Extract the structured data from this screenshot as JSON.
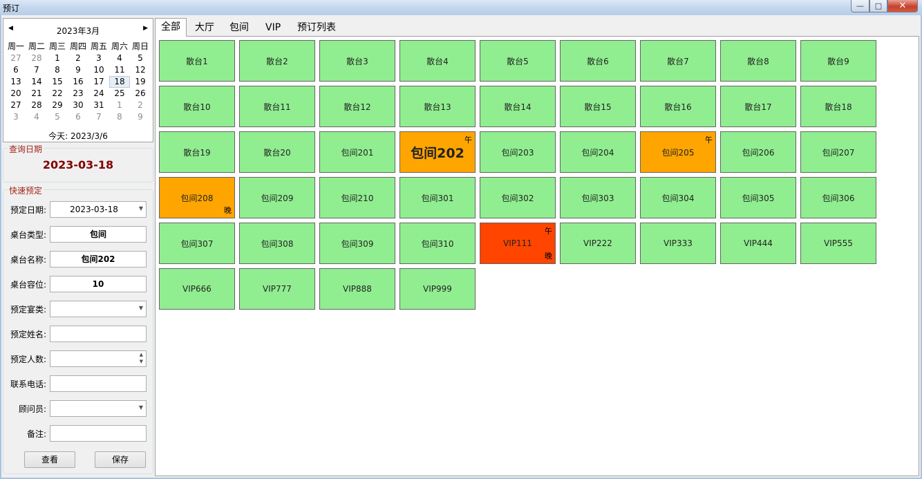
{
  "window": {
    "title": "预订",
    "buttons": {
      "minimize": "—",
      "maximize": "□",
      "close": "✕"
    }
  },
  "calendar": {
    "month_label": "2023年3月",
    "weekdays": [
      "周一",
      "周二",
      "周三",
      "周四",
      "周五",
      "周六",
      "周日"
    ],
    "weeks": [
      [
        "27",
        "28",
        "1",
        "2",
        "3",
        "4",
        "5"
      ],
      [
        "6",
        "7",
        "8",
        "9",
        "10",
        "11",
        "12"
      ],
      [
        "13",
        "14",
        "15",
        "16",
        "17",
        "18",
        "19"
      ],
      [
        "20",
        "21",
        "22",
        "23",
        "24",
        "25",
        "26"
      ],
      [
        "27",
        "28",
        "29",
        "30",
        "31",
        "1",
        "2"
      ],
      [
        "3",
        "4",
        "5",
        "6",
        "7",
        "8",
        "9"
      ]
    ],
    "selected_day": "18",
    "today_label": "今天: 2023/3/6"
  },
  "query": {
    "legend": "查询日期",
    "date": "2023-03-18"
  },
  "quick_booking": {
    "legend": "快速预定",
    "fields": [
      {
        "label": "预定日期:",
        "value": "2023-03-18",
        "kind": "combo"
      },
      {
        "label": "桌台类型:",
        "value": "包间",
        "kind": "text"
      },
      {
        "label": "桌台名称:",
        "value": "包间202",
        "kind": "text"
      },
      {
        "label": "桌台容位:",
        "value": "10",
        "kind": "text"
      },
      {
        "label": "预定宴类:",
        "value": "",
        "kind": "combo"
      },
      {
        "label": "预定姓名:",
        "value": "",
        "kind": "text"
      },
      {
        "label": "预定人数:",
        "value": "",
        "kind": "spin"
      },
      {
        "label": "联系电话:",
        "value": "",
        "kind": "text"
      },
      {
        "label": "顾问员:",
        "value": "",
        "kind": "combo"
      },
      {
        "label": "备注:",
        "value": "",
        "kind": "text"
      }
    ],
    "view_button": "查看",
    "save_button": "保存"
  },
  "tabs": [
    "全部",
    "大厅",
    "包间",
    "VIP",
    "预订列表"
  ],
  "active_tab": "全部",
  "status_colors": {
    "available": "#90ee90",
    "partial": "#ffa500",
    "full": "#ff4500"
  },
  "tables": [
    {
      "name": "散台1",
      "status": "available"
    },
    {
      "name": "散台2",
      "status": "available"
    },
    {
      "name": "散台3",
      "status": "available"
    },
    {
      "name": "散台4",
      "status": "available"
    },
    {
      "name": "散台5",
      "status": "available"
    },
    {
      "name": "散台6",
      "status": "available"
    },
    {
      "name": "散台7",
      "status": "available"
    },
    {
      "name": "散台8",
      "status": "available"
    },
    {
      "name": "散台9",
      "status": "available"
    },
    {
      "name": "散台10",
      "status": "available"
    },
    {
      "name": "散台11",
      "status": "available"
    },
    {
      "name": "散台12",
      "status": "available"
    },
    {
      "name": "散台13",
      "status": "available"
    },
    {
      "name": "散台14",
      "status": "available"
    },
    {
      "name": "散台15",
      "status": "available"
    },
    {
      "name": "散台16",
      "status": "available"
    },
    {
      "name": "散台17",
      "status": "available"
    },
    {
      "name": "散台18",
      "status": "available"
    },
    {
      "name": "散台19",
      "status": "available"
    },
    {
      "name": "散台20",
      "status": "available"
    },
    {
      "name": "包间201",
      "status": "available"
    },
    {
      "name": "包间202",
      "status": "partial",
      "noon": "午",
      "highlight": true
    },
    {
      "name": "包间203",
      "status": "available"
    },
    {
      "name": "包间204",
      "status": "available"
    },
    {
      "name": "包间205",
      "status": "partial",
      "noon": "午"
    },
    {
      "name": "包间206",
      "status": "available"
    },
    {
      "name": "包间207",
      "status": "available"
    },
    {
      "name": "包间208",
      "status": "partial",
      "evening": "晚"
    },
    {
      "name": "包间209",
      "status": "available"
    },
    {
      "name": "包间210",
      "status": "available"
    },
    {
      "name": "包间301",
      "status": "available"
    },
    {
      "name": "包间302",
      "status": "available"
    },
    {
      "name": "包间303",
      "status": "available"
    },
    {
      "name": "包间304",
      "status": "available"
    },
    {
      "name": "包间305",
      "status": "available"
    },
    {
      "name": "包间306",
      "status": "available"
    },
    {
      "name": "包间307",
      "status": "available"
    },
    {
      "name": "包间308",
      "status": "available"
    },
    {
      "name": "包间309",
      "status": "available"
    },
    {
      "name": "包间310",
      "status": "available"
    },
    {
      "name": "VIP111",
      "status": "full",
      "noon": "午",
      "evening": "晚"
    },
    {
      "name": "VIP222",
      "status": "available"
    },
    {
      "name": "VIP333",
      "status": "available"
    },
    {
      "name": "VIP444",
      "status": "available"
    },
    {
      "name": "VIP555",
      "status": "available"
    },
    {
      "name": "VIP666",
      "status": "available"
    },
    {
      "name": "VIP777",
      "status": "available"
    },
    {
      "name": "VIP888",
      "status": "available"
    },
    {
      "name": "VIP999",
      "status": "available"
    }
  ]
}
